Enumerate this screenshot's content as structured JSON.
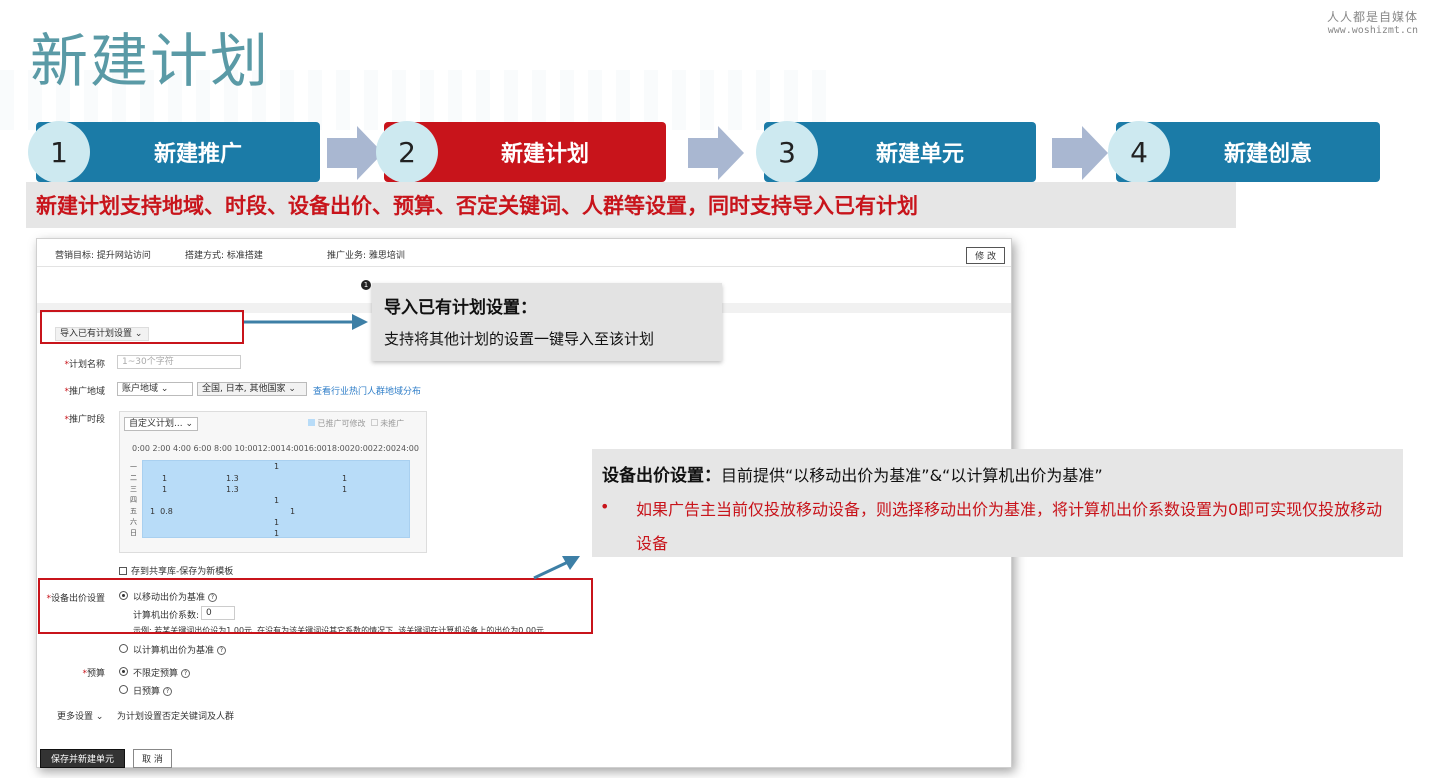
{
  "header": {
    "title": "新建计划",
    "brand_name": "人人都是自媒体",
    "brand_url": "www.woshizmt.cn"
  },
  "steps": [
    {
      "number": "1",
      "label": "新建推广",
      "state": "done",
      "color": "#1b7ba7"
    },
    {
      "number": "2",
      "label": "新建计划",
      "state": "active",
      "color": "#c8141b"
    },
    {
      "number": "3",
      "label": "新建单元",
      "state": "pending",
      "color": "#1b7ba7"
    },
    {
      "number": "4",
      "label": "新建创意",
      "state": "pending",
      "color": "#1b7ba7"
    }
  ],
  "description": "新建计划支持地域、时段、设备出价、预算、否定关键词、人群等设置，同时支持导入已有计划",
  "screenshot": {
    "marketing_goal": "营销目标:  提升网站访问",
    "build_method": "搭建方式:  标准搭建",
    "business": "推广业务:  雅思培训",
    "modify_label": "修 改",
    "step_marker": "1",
    "import_label": "导入已有计划设置",
    "plan_name_label": "计划名称",
    "plan_name_placeholder": "1~30个字符",
    "region_label": "推广地域",
    "region_select": "账户地域",
    "region_value": "全国, 日本, 其他国家",
    "region_link": "查看行业热门人群地域分布",
    "time_label": "推广时段",
    "time_select": "自定义计划...",
    "legend_editable": "已推广可修改",
    "legend_none": "未推广",
    "hours": "0:00 2:00 4:00 6:00 8:00 10:0012:0014:0016:0018:0020:0022:0024:00",
    "days": [
      "一",
      "二",
      "三",
      "四",
      "五",
      "六",
      "日"
    ],
    "save_template": "存到共享库-保存为新模板",
    "device_label": "设备出价设置",
    "mobile_base": "以移动出价为基准",
    "pc_coeff_label": "计算机出价系数:",
    "pc_coeff_value": "0",
    "example": "示例:  若某关键词出价设为1.00元, 在没有为该关键词设其它系数的情况下, 该关键词在计算机设备上的出价为0.00元",
    "pc_base": "以计算机出价为基准",
    "budget_label": "预算",
    "budget_unlimited": "不限定预算",
    "budget_daily": "日预算",
    "more_settings": "更多设置",
    "more_settings_desc": "为计划设置否定关键词及人群",
    "save_button": "保存并新建单元",
    "cancel_button": "取 消"
  },
  "callout_import": {
    "heading": "导入已有计划设置：",
    "text": "支持将其他计划的设置一键导入至该计划"
  },
  "callout_device": {
    "heading": "设备出价设置：",
    "text": "目前提供“以移动出价为基准”&“以计算机出价为基准”",
    "bullet": "•",
    "bullet_text": "如果广告主当前仅投放移动设备，则选择移动出价为基准，将计算机出价系数设置为0即可实现仅投放移动设备"
  }
}
